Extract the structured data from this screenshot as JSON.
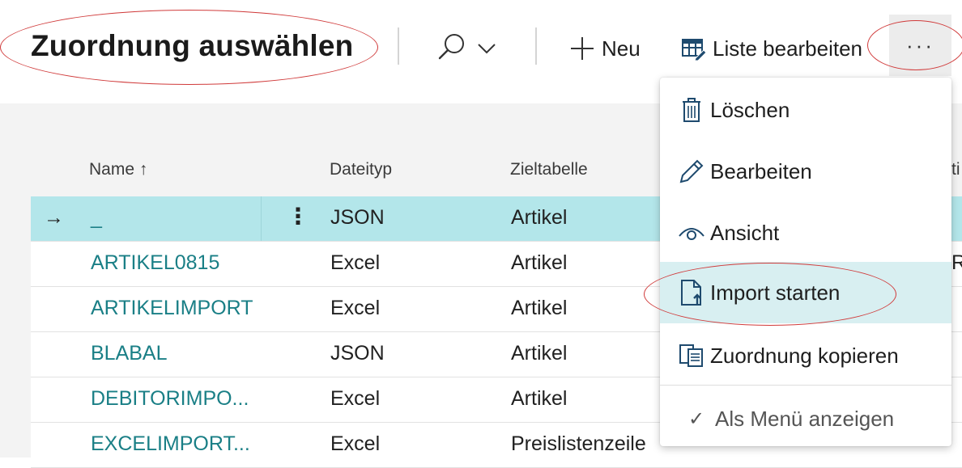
{
  "page": {
    "title": "Zuordnung auswählen"
  },
  "toolbar": {
    "new_label": "Neu",
    "edit_list_label": "Liste bearbeiten",
    "more_label": "···"
  },
  "table": {
    "columns": {
      "name": "Name ↑",
      "filetype": "Dateityp",
      "target": "Zieltabelle",
      "partial_right": "ti"
    },
    "rows": [
      {
        "name": "_",
        "filetype": "JSON",
        "target": "Artikel",
        "extra": "",
        "selected": true
      },
      {
        "name": "ARTIKEL0815",
        "filetype": "Excel",
        "target": "Artikel",
        "extra": "RT"
      },
      {
        "name": "ARTIKELIMPORT",
        "filetype": "Excel",
        "target": "Artikel",
        "extra": ""
      },
      {
        "name": "BLABAL",
        "filetype": "JSON",
        "target": "Artikel",
        "extra": ""
      },
      {
        "name": "DEBITORIMPO...",
        "filetype": "Excel",
        "target": "Artikel",
        "extra": ""
      },
      {
        "name": "EXCELIMPORT...",
        "filetype": "Excel",
        "target": "Preislistenzeile",
        "extra": ""
      }
    ],
    "selected_arrow": "→",
    "row_menu": "⋮"
  },
  "menu": {
    "items": [
      {
        "label": "Löschen",
        "icon": "trash-icon"
      },
      {
        "label": "Bearbeiten",
        "icon": "pencil-icon"
      },
      {
        "label": "Ansicht",
        "icon": "eye-icon"
      },
      {
        "label": "Import starten",
        "icon": "file-upload-icon",
        "highlighted": true
      },
      {
        "label": "Zuordnung kopieren",
        "icon": "copy-icon"
      }
    ],
    "show_as_menu": "Als Menü anzeigen",
    "show_as_menu_check": "✓"
  },
  "colors": {
    "link": "#1a7f86",
    "selected_row": "#b3e6ea",
    "menu_highlight": "#d8eff1",
    "annotation": "#d03a3a"
  }
}
